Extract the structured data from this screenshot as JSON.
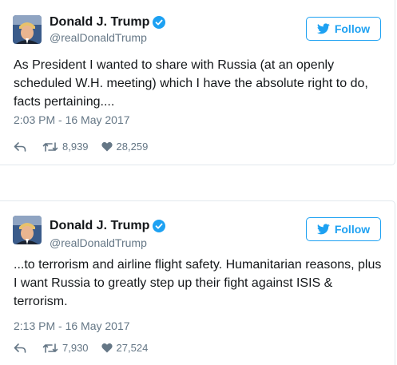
{
  "tweets": [
    {
      "name": "Donald J. Trump",
      "handle": "@realDonaldTrump",
      "follow_label": "Follow",
      "text": "As President I wanted to share with Russia (at an openly scheduled W.H. meeting) which I have the absolute right to do, facts pertaining....",
      "timestamp": "2:03 PM - 16 May 2017",
      "retweets": "8,939",
      "likes": "28,259"
    },
    {
      "name": "Donald J. Trump",
      "handle": "@realDonaldTrump",
      "follow_label": "Follow",
      "text": "...to terrorism and airline flight safety. Humanitarian reasons, plus I want Russia to greatly step up their fight against ISIS & terrorism.",
      "timestamp": "2:13 PM - 16 May 2017",
      "retweets": "7,930",
      "likes": "27,524"
    }
  ],
  "icons": {
    "verified": "verified-badge-icon",
    "follow": "twitter-bird-icon",
    "reply": "reply-icon",
    "retweet": "retweet-icon",
    "like": "heart-icon"
  },
  "colors": {
    "accent": "#1da1f2",
    "muted": "#657786",
    "text": "#14171a",
    "border": "#e1e8ed"
  }
}
